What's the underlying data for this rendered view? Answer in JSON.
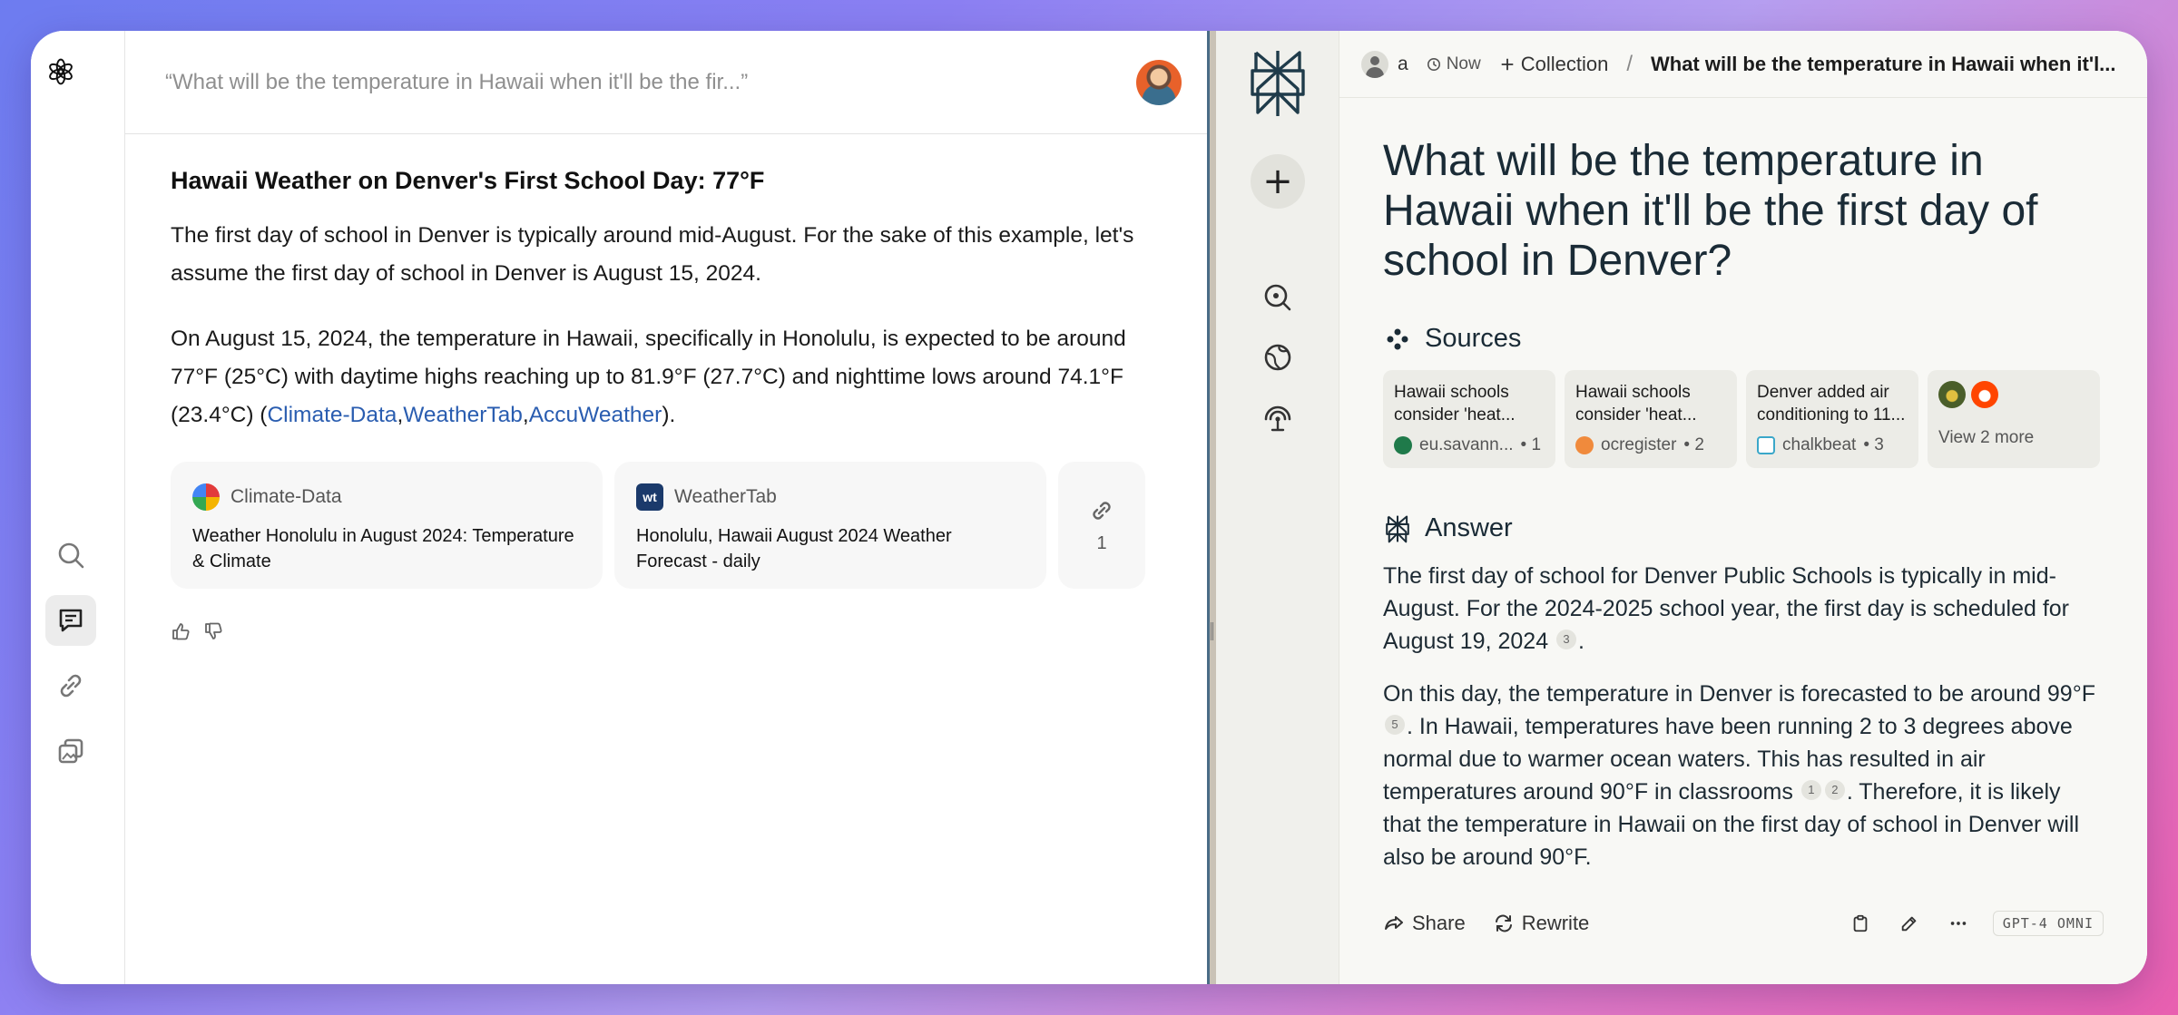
{
  "left": {
    "header": {
      "question": "“What will be the temperature in Hawaii when it'll be the fir...”"
    },
    "answer": {
      "title": "Hawaii Weather on Denver's First School Day: 77°F",
      "p1": "The first day of school in Denver is typically around mid-August. For the sake of this example, let's assume the first day of school in Denver is August 15, 2024.",
      "p2_text": "On August 15, 2024, the temperature in Hawaii, specifically in Honolulu, is expected to be around 77°F (25°C) with daytime highs reaching up to 81.9°F (27.7°C) and nighttime lows around 74.1°F (23.4°C) (",
      "link1": "Climate-Data",
      "comma1": ",",
      "link2": "WeatherTab",
      "comma2": ",",
      "link3": "AccuWeather",
      "p2_end": ")."
    },
    "cards": [
      {
        "source": "Climate-Data",
        "title": "Weather Honolulu in August 2024: Temperature & Climate"
      },
      {
        "source": "WeatherTab",
        "title": "Honolulu, Hawaii August 2024 Weather Forecast - daily"
      }
    ],
    "link_card": {
      "count": "1"
    }
  },
  "right": {
    "topbar": {
      "user": "a",
      "time": "Now",
      "collection": "Collection",
      "separator": "/",
      "crumb": "What will be the temperature in Hawaii when it'l..."
    },
    "title": "What will be the temperature in Hawaii when it'll be the first day of school in Denver?",
    "sources_label": "Sources",
    "sources": [
      {
        "title": "Hawaii schools consider 'heat...",
        "site": "eu.savann...",
        "num": "• 1",
        "color": "#1f7a4a"
      },
      {
        "title": "Hawaii schools consider 'heat...",
        "site": "ocregister",
        "num": "• 2",
        "color": "#f08a3c"
      },
      {
        "title": "Denver added air conditioning to 11...",
        "site": "chalkbeat",
        "num": "• 3",
        "color": "#3aa7c9"
      }
    ],
    "view_more": "View 2 more",
    "answer_label": "Answer",
    "answer": {
      "p1a": "The first day of school for Denver Public Schools is typically in mid-August. For the 2024-2025 school year, the first day is scheduled for August 19, 2024",
      "c3": "3",
      "p1b": ".",
      "p2a": "On this day, the temperature in Denver is forecasted to be around 99°F",
      "c5": "5",
      "p2b": ". In Hawaii, temperatures have been running 2 to 3 degrees above normal due to warmer ocean waters. This has resulted in air temperatures around 90°F in classrooms",
      "c1": "1",
      "c2": "2",
      "p2c": ". Therefore, it is likely that the temperature in Hawaii on the first day of school in Denver will also be around 90°F."
    },
    "actions": {
      "share": "Share",
      "rewrite": "Rewrite",
      "model": "GPT-4 OMNI"
    }
  }
}
